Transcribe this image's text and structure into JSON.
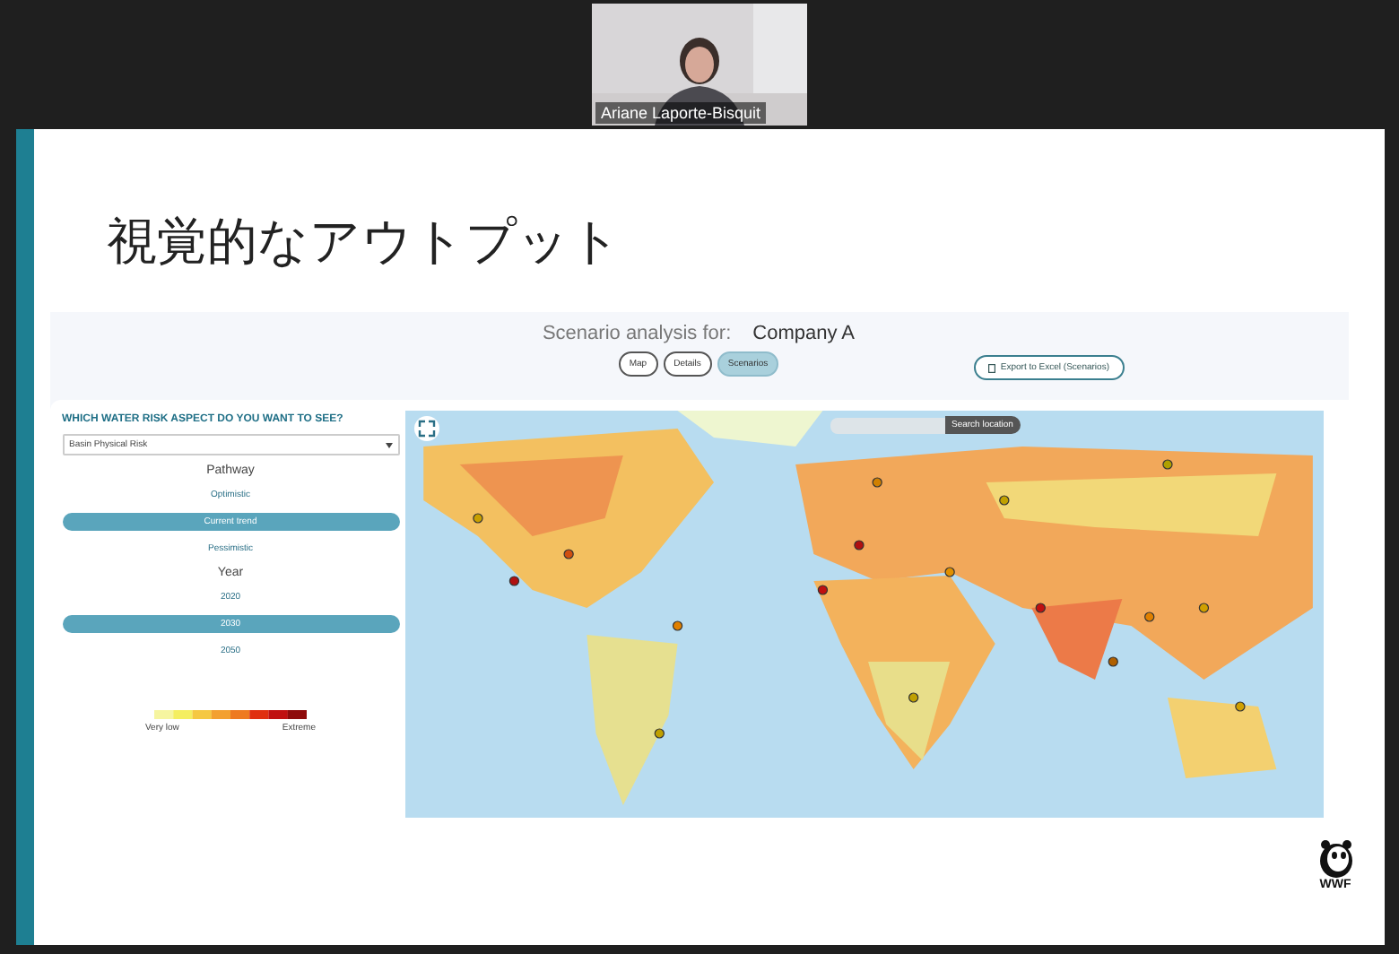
{
  "meeting": {
    "participant": {
      "name": "Ariane Laporte-Bisquit"
    }
  },
  "slide": {
    "title": "視覚的なアウトプット",
    "app": {
      "heading_label": "Scenario analysis for:",
      "company": "Company A",
      "view_tabs": [
        {
          "label": "Map",
          "selected": false
        },
        {
          "label": "Details",
          "selected": false
        },
        {
          "label": "Scenarios",
          "selected": true
        }
      ],
      "export_button": "Export to Excel (Scenarios)",
      "question": "WHICH WATER RISK ASPECT DO YOU WANT TO SEE?",
      "risk_select": {
        "value": "Basin Physical Risk"
      },
      "pathway": {
        "label": "Pathway",
        "options": [
          {
            "label": "Optimistic",
            "selected": false
          },
          {
            "label": "Current trend",
            "selected": true
          },
          {
            "label": "Pessimistic",
            "selected": false
          }
        ]
      },
      "year": {
        "label": "Year",
        "options": [
          {
            "label": "2020",
            "selected": false
          },
          {
            "label": "2030",
            "selected": true
          },
          {
            "label": "2050",
            "selected": false
          }
        ]
      },
      "legend": {
        "low_label": "Very low",
        "high_label": "Extreme"
      },
      "map": {
        "kind": "picture",
        "search_button": "Search location"
      }
    },
    "logo": {
      "text": "WWF"
    }
  }
}
